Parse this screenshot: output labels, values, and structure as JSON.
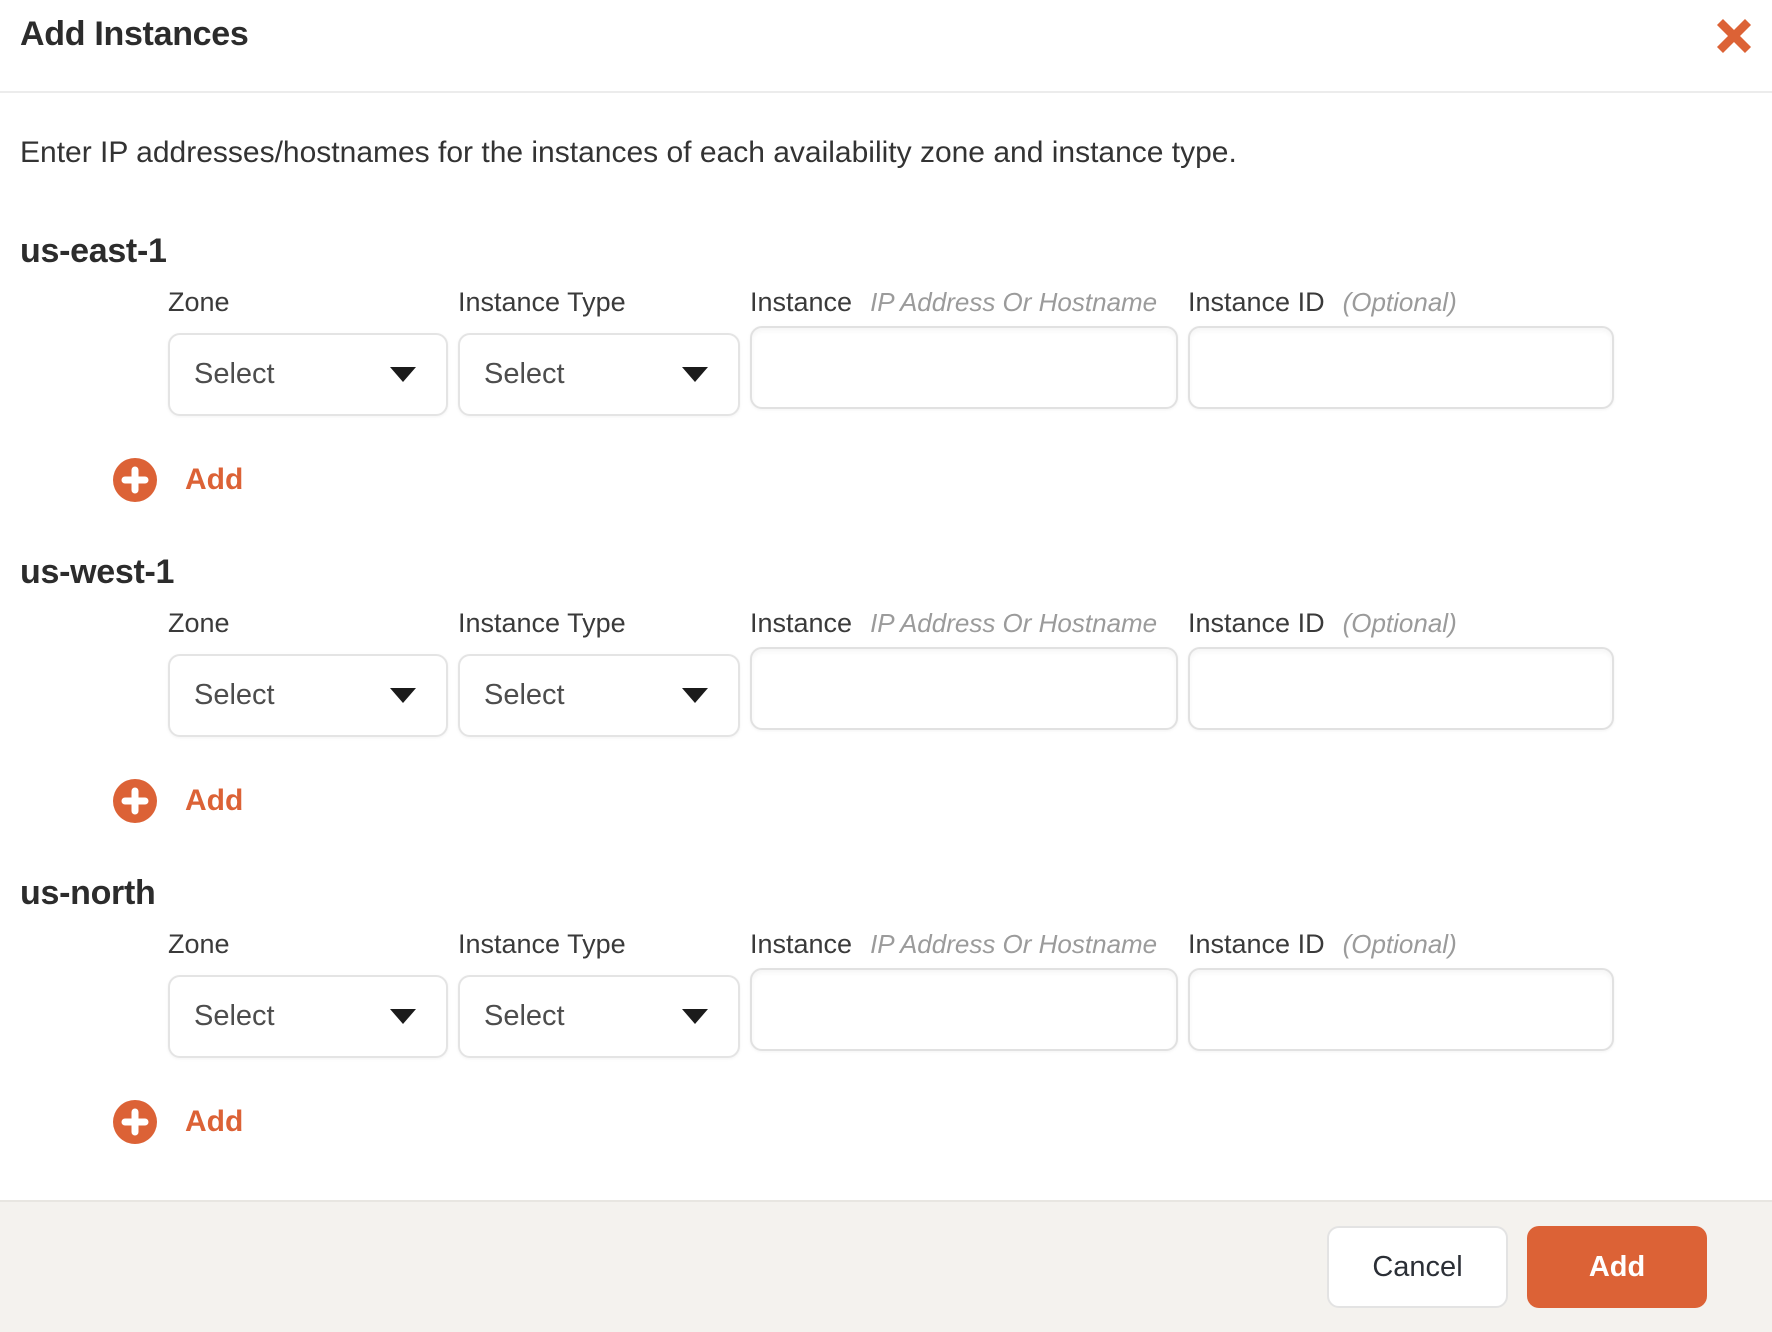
{
  "colors": {
    "accent": "#DC6236",
    "footer_background": "#F4F2EE",
    "hint_text": "#9B9B9B",
    "border": "#E2E2E2"
  },
  "header": {
    "title": "Add Instances",
    "close_icon": "x-icon"
  },
  "description": "Enter IP addresses/hostnames for the instances of each availability zone and instance type.",
  "field_labels": {
    "zone": "Zone",
    "instance_type": "Instance Type",
    "instance": "Instance",
    "instance_hint": "IP Address Or Hostname",
    "instance_id": "Instance ID",
    "instance_id_hint": "(Optional)",
    "select_placeholder": "Select",
    "add_row": "Add"
  },
  "icons": {
    "add_row": "plus-circle-icon",
    "select_caret": "caret-down-icon"
  },
  "sections": [
    {
      "name": "us-east-1"
    },
    {
      "name": "us-west-1"
    },
    {
      "name": "us-north"
    }
  ],
  "inputs": {
    "instance_value": "",
    "instance_id_value": ""
  },
  "footer": {
    "cancel_label": "Cancel",
    "add_label": "Add"
  }
}
